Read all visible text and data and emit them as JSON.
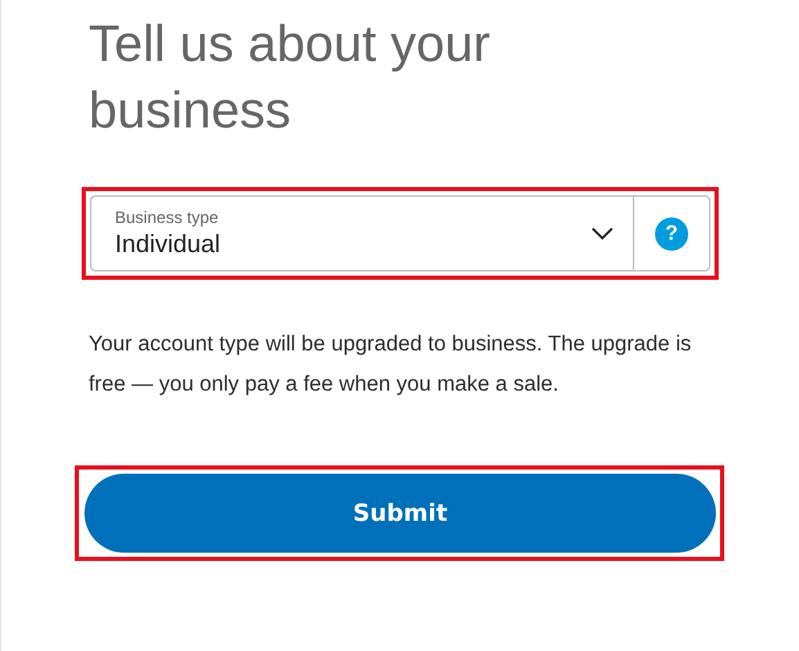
{
  "heading": "Tell us about your business",
  "business_type": {
    "label": "Business type",
    "value": "Individual",
    "highlighted": true,
    "help": "?"
  },
  "note": "Your account type will be upgraded to business. The upgrade is free — you only pay a fee when you make a sale.",
  "submit": {
    "label": "Submit",
    "highlighted": true
  }
}
